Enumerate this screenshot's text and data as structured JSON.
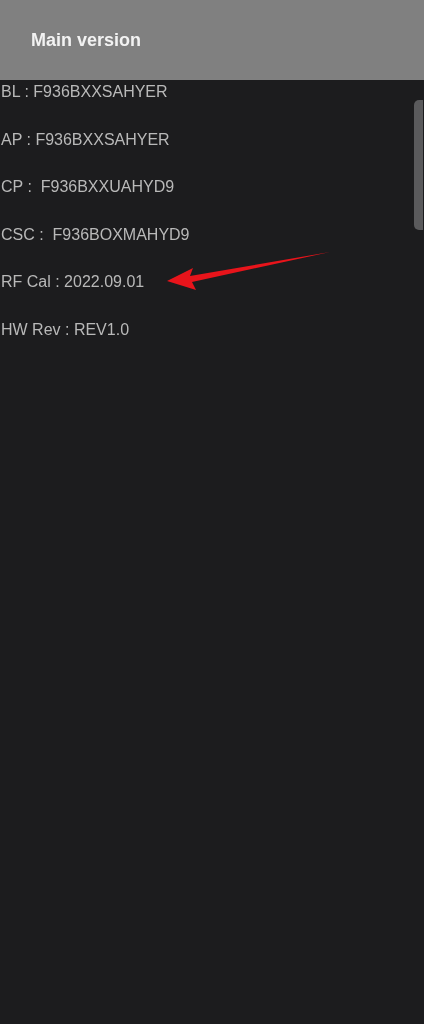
{
  "header": {
    "title": "Main version"
  },
  "info_lines": [
    "BL : F936BXXSAHYER",
    "AP : F936BXXSAHYER",
    "CP :  F936BXXUAHYD9",
    "CSC :  F936BOXMAHYD9",
    "RF Cal : 2022.09.01",
    "HW Rev : REV1.0"
  ]
}
